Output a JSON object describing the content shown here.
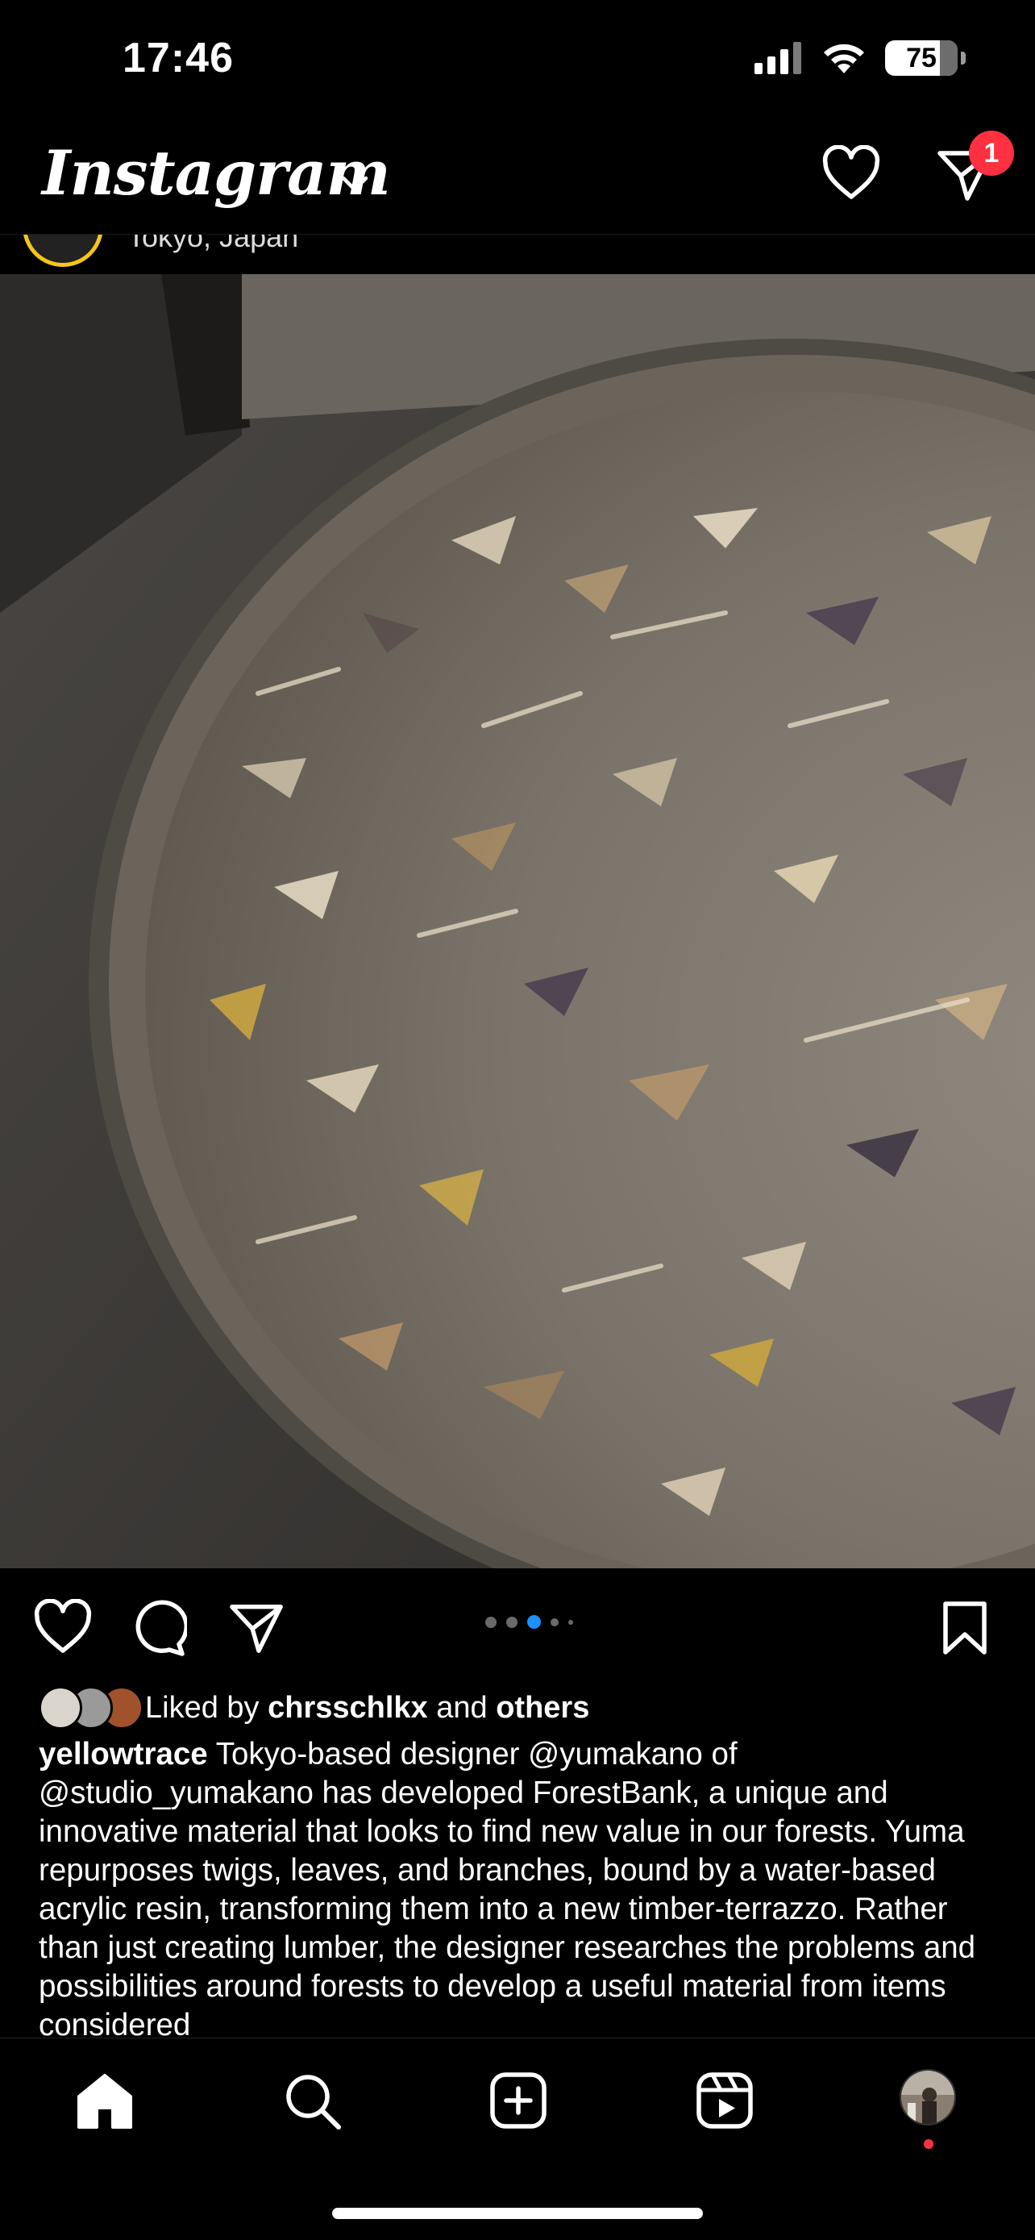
{
  "status": {
    "time": "17:46",
    "battery": "75",
    "icons": [
      "cellular-signal-icon",
      "wifi-icon",
      "battery-icon"
    ]
  },
  "header": {
    "logo": "Instagram",
    "notification_count": "1",
    "icons": [
      "chevron-down-icon",
      "heart-icon",
      "direct-message-icon"
    ]
  },
  "post": {
    "location": "Tokyo, Japan",
    "carousel": {
      "total": 5,
      "active_index": 2
    },
    "likes": {
      "prefix": "Liked by",
      "first_user": "chrsschlkx",
      "connector": "and",
      "rest": "others"
    },
    "caption": {
      "username": "yellowtrace",
      "text": "Tokyo-based designer @yumakano of @studio_yumakano has developed ForestBank, a unique and innovative material that looks to find new value in our forests. Yuma repurposes twigs, leaves, and branches, bound by a water-based acrylic resin, transforming them into a new timber-terrazzo. Rather than just creating lumber, the designer researches the problems and possibilities around forests to develop a useful material from items considered"
    }
  },
  "tabbar": {
    "items": [
      "home-icon",
      "search-icon",
      "create-icon",
      "reels-icon",
      "profile-avatar"
    ]
  },
  "colors": {
    "background": "#000000",
    "badge": "#ff3040",
    "carousel_active": "#1d8fff"
  }
}
